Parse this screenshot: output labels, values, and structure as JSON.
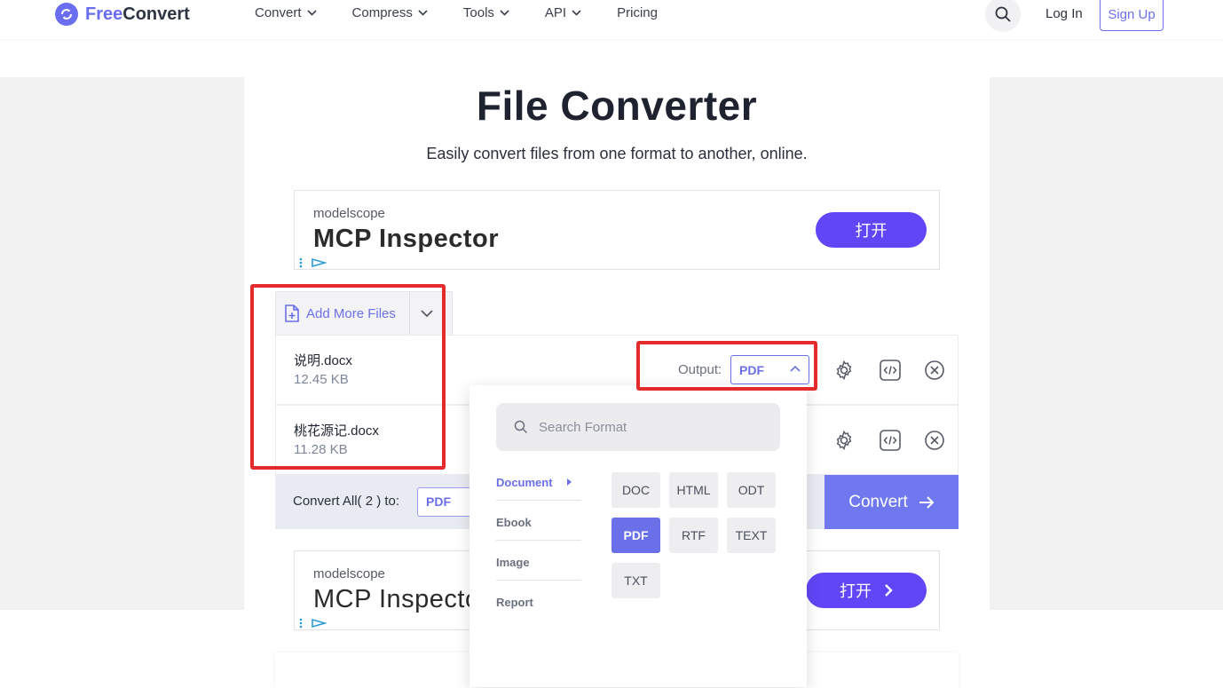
{
  "header": {
    "brand_free": "Free",
    "brand_convert": "Convert",
    "nav": [
      "Convert",
      "Compress",
      "Tools",
      "API",
      "Pricing"
    ],
    "login": "Log In",
    "signup": "Sign Up"
  },
  "hero": {
    "title": "File Converter",
    "subtitle": "Easily convert files from one format to another, online."
  },
  "ads": [
    {
      "brand": "modelscope",
      "title": "MCP Inspector",
      "button": "打开"
    },
    {
      "brand": "modelscope",
      "title": "MCP Inspecto",
      "button": "打开"
    }
  ],
  "files": {
    "add_more": "Add More Files",
    "items": [
      {
        "name": "说明.docx",
        "size": "12.45 KB"
      },
      {
        "name": "桃花源记.docx",
        "size": "11.28 KB"
      }
    ],
    "output_label": "Output:",
    "output_value": "PDF"
  },
  "convert_bar": {
    "label": "Convert All( 2 ) to:",
    "value": "PDF",
    "button": "Convert"
  },
  "dropdown": {
    "search_placeholder": "Search Format",
    "categories": [
      "Document",
      "Ebook",
      "Image",
      "Report"
    ],
    "active_category": "Document",
    "formats": [
      "DOC",
      "HTML",
      "ODT",
      "PDF",
      "RTF",
      "TEXT",
      "TXT"
    ],
    "selected_format": "PDF"
  },
  "colors": {
    "accent": "#6b6fe8",
    "convert_button": "#7078ef",
    "ad_button": "#6046f7",
    "highlight": "#e32b2b"
  },
  "icons": [
    "logo-icon",
    "chevron-down-icon",
    "search-icon",
    "file-plus-icon",
    "chevron-up-icon",
    "gear-icon",
    "code-icon",
    "close-circle-icon",
    "arrow-right-icon",
    "chevron-right-icon",
    "ad-info-icon",
    "ad-choices-icon"
  ]
}
